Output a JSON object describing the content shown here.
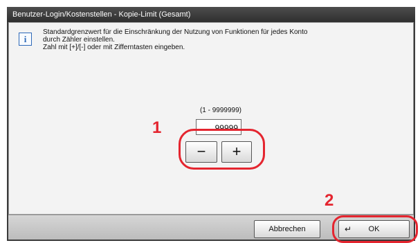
{
  "title": "Benutzer-Login/Kostenstellen - Kopie-Limit (Gesamt)",
  "message": {
    "line1": "Standardgrenzwert für die Einschränkung der Nutzung von Funktionen für jedes Konto",
    "line2": "durch Zähler einstellen.",
    "line3": "Zahl mit [+]/[-] oder mit Zifferntasten eingeben."
  },
  "counter": {
    "range": "(1 - 9999999)",
    "value": "99999"
  },
  "buttons": {
    "minus": "−",
    "plus": "+",
    "cancel": "Abbrechen",
    "ok": "OK",
    "ok_icon": "↵"
  },
  "annotations": {
    "step1": "1",
    "step2": "2",
    "color": "#e4252f"
  },
  "icons": {
    "info": "i"
  }
}
